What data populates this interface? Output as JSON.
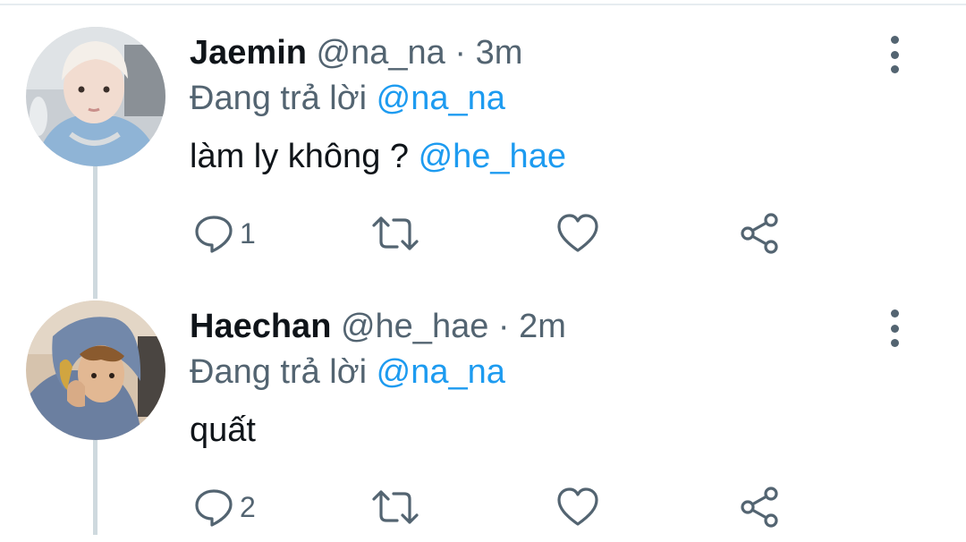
{
  "tweets": [
    {
      "display_name": "Jaemin",
      "handle": "@na_na",
      "separator": "·",
      "time": "3m",
      "reply_prefix": "Đang trả lời",
      "reply_to": "@na_na",
      "text_main": "làm ly không ? ",
      "text_mention": "@he_hae",
      "reply_count": "1",
      "avatar_icon": "user-avatar-jaemin"
    },
    {
      "display_name": "Haechan",
      "handle": "@he_hae",
      "separator": "·",
      "time": "2m",
      "reply_prefix": "Đang trả lời",
      "reply_to": "@na_na",
      "text_main": "quất",
      "text_mention": "",
      "reply_count": "2",
      "avatar_icon": "user-avatar-haechan"
    }
  ],
  "colors": {
    "text_primary": "#0f1419",
    "text_secondary": "#536471",
    "mention": "#1d9bf0",
    "thread_line": "#cfd9de"
  },
  "icons": [
    "reply-icon",
    "retweet-icon",
    "like-icon",
    "share-icon",
    "more-options-icon"
  ]
}
